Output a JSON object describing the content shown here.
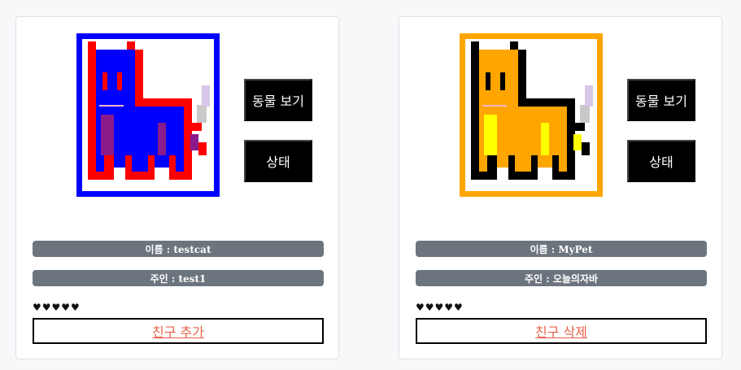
{
  "pets": [
    {
      "frame_color": "#0000ff",
      "outline_color": "#ff0000",
      "body_color": "#0000ff",
      "accent_color": "#8b1a8b",
      "view_button": "동물 보기",
      "status_button": "상태",
      "name_label": "이름 : testcat",
      "owner_label": "주인 : test1",
      "hearts": "♥♥♥♥♥",
      "friend_action": "친구 추가"
    },
    {
      "frame_color": "#ffa500",
      "outline_color": "#000000",
      "body_color": "#ffa500",
      "accent_color": "#ffff00",
      "view_button": "동물 보기",
      "status_button": "상태",
      "name_label": "이름 : MyPet",
      "owner_label": "주인 : 오늘의자바",
      "hearts": "♥♥♥♥♥",
      "friend_action": "친구 삭제"
    }
  ]
}
